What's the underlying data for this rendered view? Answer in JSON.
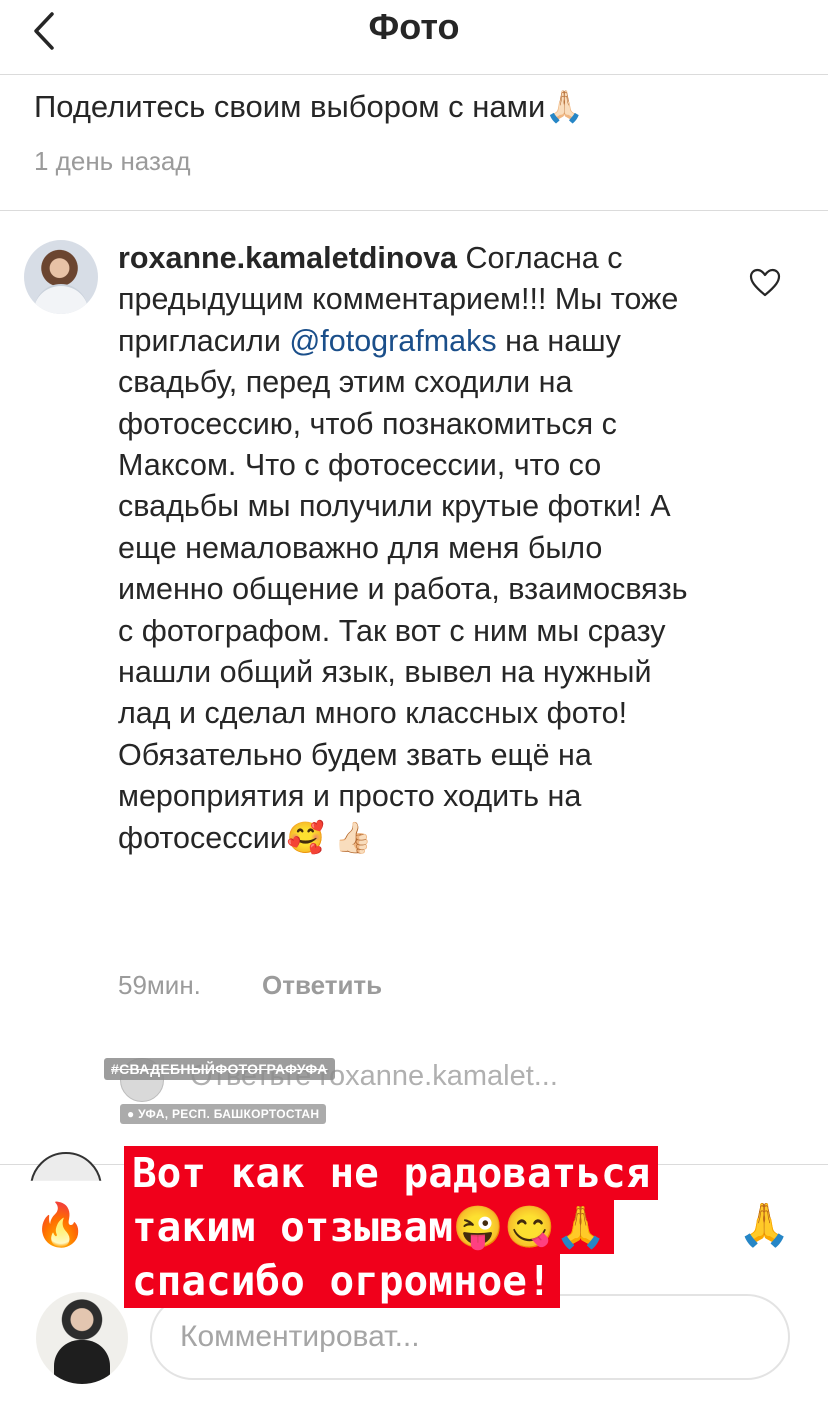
{
  "header": {
    "title": "Фото",
    "back_icon": "chevron-left-icon"
  },
  "caption": {
    "tail_text": "Поделитесь своим выбором  с нами",
    "emoji": "🙏🏻",
    "time": "1 день назад"
  },
  "comment": {
    "username": "roxanne.kamaletdinova",
    "text_before_mention": " Согласна с предыдущим комментарием!!! Мы тоже пригласили ",
    "mention": "@fotografmaks",
    "text_after_mention": " на нашу свадьбу, перед этим сходили на фотосессию, чтоб познакомиться с Максом. Что с фотосессии, что со свадьбы мы получили крутые фотки! А еще немаловажно для меня было именно общение и работа, взаимосвязь с фотографом. Так вот с ним мы сразу нашли общий язык, вывел на нужный лад и сделал много классных фото! Обязательно будем звать ещё на мероприятия и просто ходить на фотосессии",
    "emojis": "🥰 👍🏻",
    "time": "59мин.",
    "reply_label": "Ответить",
    "like_icon": "heart-outline-icon"
  },
  "reply_preview": {
    "text": "Ответьте roxanne.kamalet..."
  },
  "stickers": {
    "hashtag": "#СВАДЕБНЫЙФОТОГРАФУФА",
    "location": "● УФА, РЕСП. БАШКОРТОСТАН"
  },
  "story_overlay": {
    "lines": [
      "Вот как не радоваться",
      "таким отзывам😜😋🙏",
      "спасибо огромное!"
    ],
    "color": "#f0001b"
  },
  "quick_reactions": {
    "left": "🔥",
    "right": "🙏"
  },
  "comment_input": {
    "placeholder": "Комментироват..."
  }
}
